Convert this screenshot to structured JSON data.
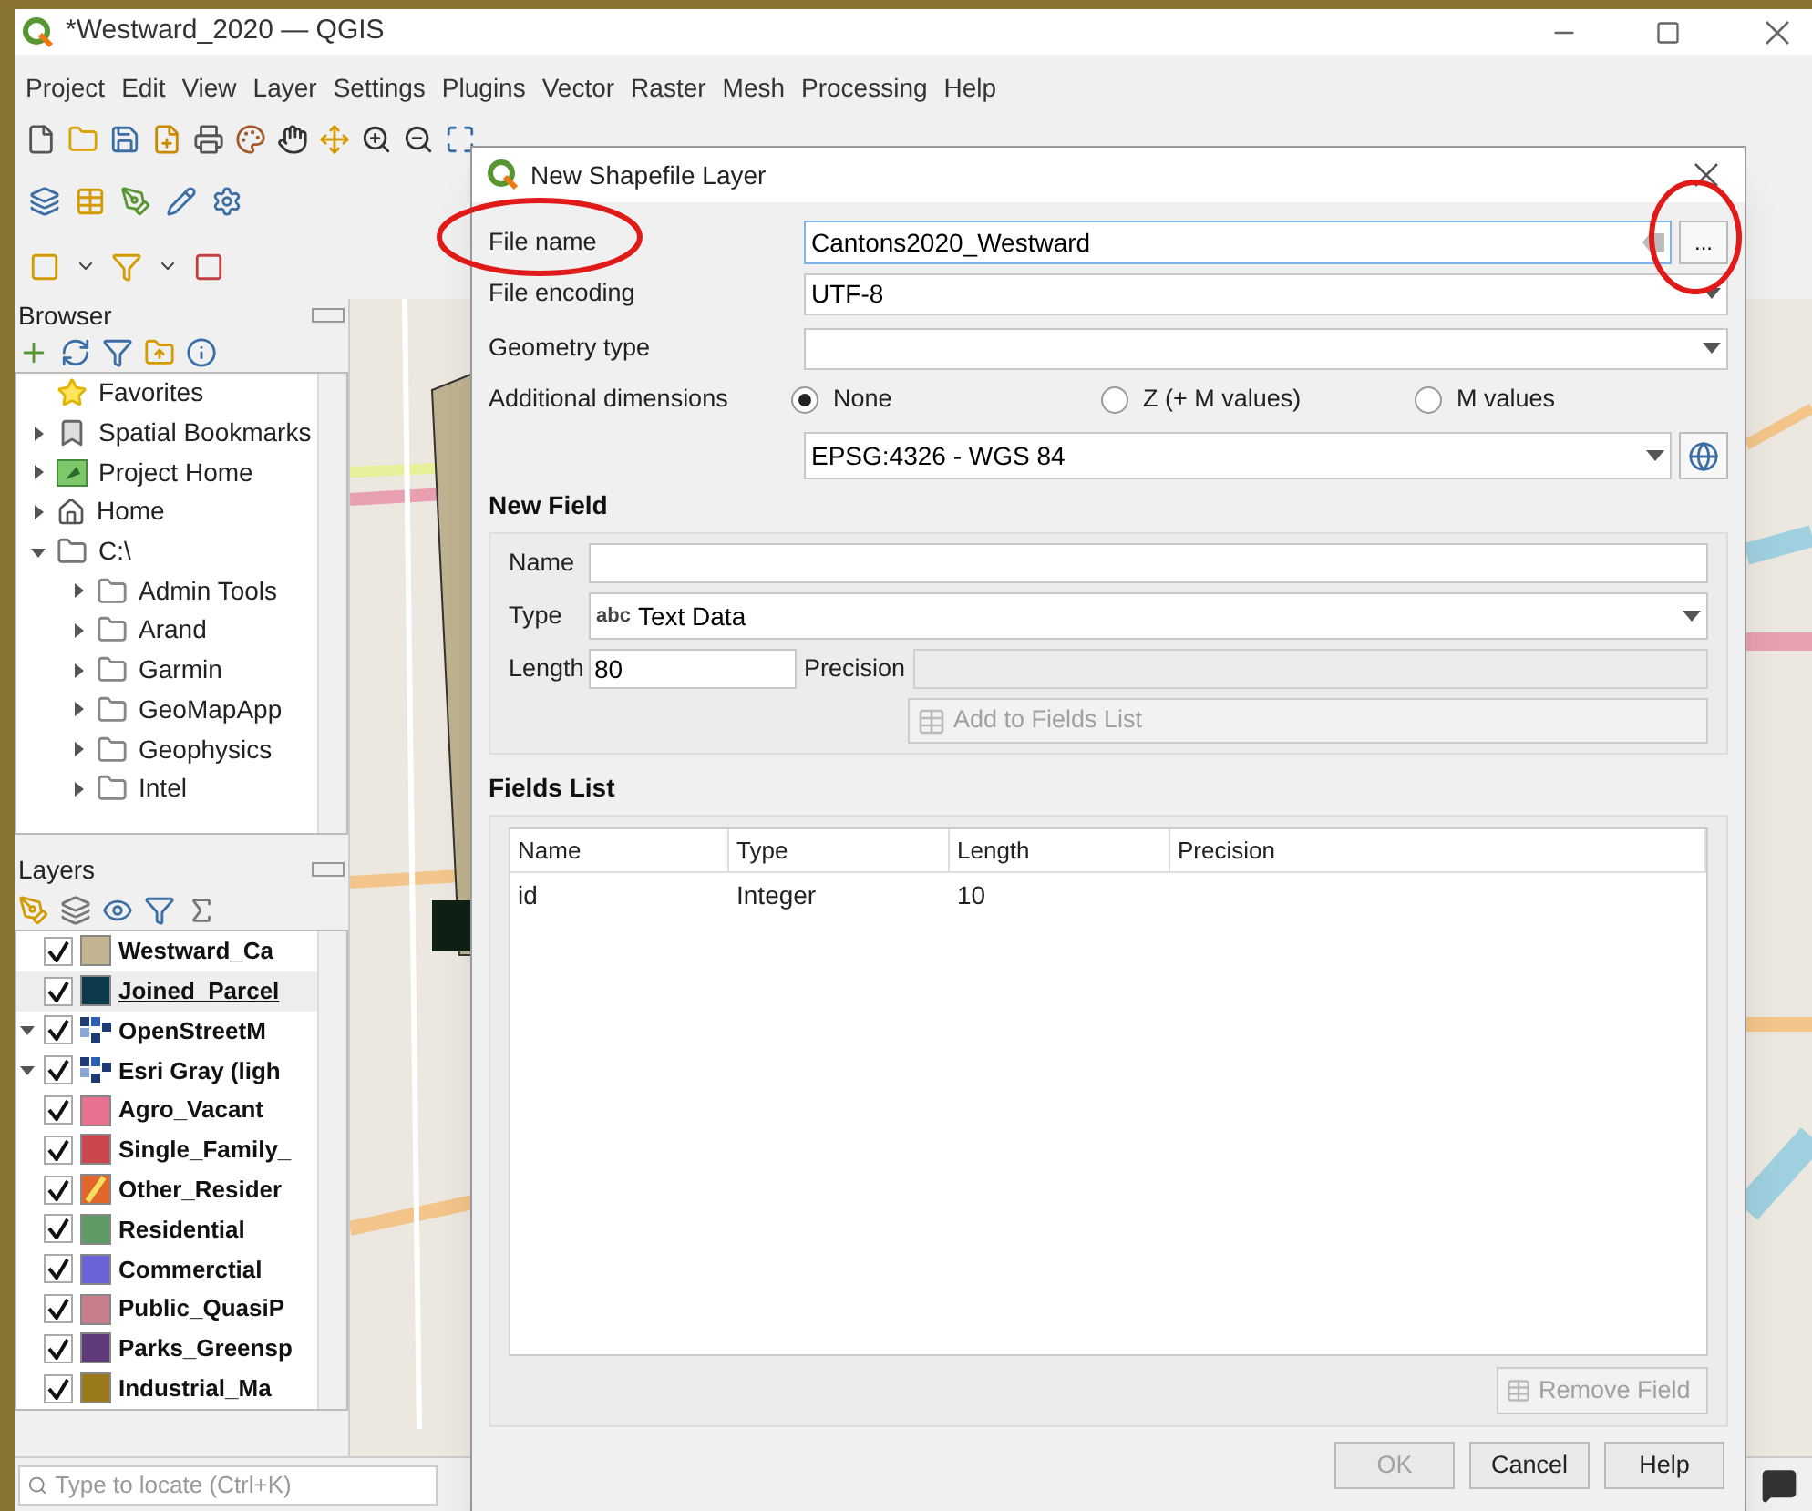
{
  "window": {
    "title": "*Westward_2020 — QGIS"
  },
  "menu": [
    "Project",
    "Edit",
    "View",
    "Layer",
    "Settings",
    "Plugins",
    "Vector",
    "Raster",
    "Mesh",
    "Processing",
    "Help"
  ],
  "browser": {
    "title": "Browser",
    "items": [
      {
        "label": "Favorites",
        "kind": "favorites"
      },
      {
        "label": "Spatial Bookmarks",
        "kind": "bookmarks",
        "expanded": false
      },
      {
        "label": "Project Home",
        "kind": "project",
        "expanded": false
      },
      {
        "label": "Home",
        "kind": "home",
        "expanded": false
      },
      {
        "label": "C:\\",
        "kind": "drive",
        "expanded": true,
        "children": [
          {
            "label": "Admin Tools",
            "kind": "folder",
            "expanded": false
          },
          {
            "label": "Arand",
            "kind": "folder",
            "expanded": false
          },
          {
            "label": "Garmin",
            "kind": "folder",
            "expanded": false
          },
          {
            "label": "GeoMapApp",
            "kind": "folder",
            "expanded": false
          },
          {
            "label": "Geophysics",
            "kind": "folder",
            "expanded": false
          },
          {
            "label": "Intel",
            "kind": "folder",
            "expanded": false
          }
        ]
      }
    ]
  },
  "layers": {
    "title": "Layers",
    "items": [
      {
        "label": "Westward_Ca",
        "kind": "fill",
        "color": "#c2b491",
        "checked": true,
        "selected": false
      },
      {
        "label": "Joined_Parcel",
        "kind": "fill",
        "color": "#0d3a4a",
        "checked": true,
        "selected": true
      },
      {
        "label": "OpenStreetM",
        "kind": "raster",
        "checked": true,
        "selected": false,
        "expanded": true
      },
      {
        "label": "Esri Gray (ligh",
        "kind": "raster",
        "checked": true,
        "selected": false,
        "expanded": true
      },
      {
        "label": "Agro_Vacant",
        "kind": "fill",
        "color": "#e8718f",
        "checked": true,
        "selected": false
      },
      {
        "label": "Single_Family_",
        "kind": "fill",
        "color": "#c9474d",
        "checked": true,
        "selected": false
      },
      {
        "label": "Other_Resider",
        "kind": "hatch",
        "color": "#e0662c",
        "checked": true,
        "selected": false
      },
      {
        "label": "Residential",
        "kind": "fill",
        "color": "#5f9a66",
        "checked": true,
        "selected": false
      },
      {
        "label": "Commerctial",
        "kind": "fill",
        "color": "#6b64d8",
        "checked": true,
        "selected": false
      },
      {
        "label": "Public_QuasiP",
        "kind": "fill",
        "color": "#c7808b",
        "checked": true,
        "selected": false
      },
      {
        "label": "Parks_Greensp",
        "kind": "fill",
        "color": "#5e3b78",
        "checked": true,
        "selected": false
      },
      {
        "label": "Industrial_Ma",
        "kind": "fill",
        "color": "#9a7a1d",
        "checked": true,
        "selected": false
      }
    ]
  },
  "locator": {
    "placeholder": "Type to locate (Ctrl+K)"
  },
  "dialog": {
    "title": "New Shapefile Layer",
    "file_name": {
      "label": "File name",
      "value": "Cantons2020_Westward",
      "browse": "..."
    },
    "file_encoding": {
      "label": "File encoding",
      "value": "UTF-8"
    },
    "geometry_type": {
      "label": "Geometry type"
    },
    "additional_dimensions": {
      "label": "Additional dimensions",
      "options": [
        {
          "label": "None",
          "selected": true
        },
        {
          "label": "Z (+ M values)",
          "selected": false
        },
        {
          "label": "M values",
          "selected": false
        }
      ]
    },
    "crs": {
      "value": "EPSG:4326 - WGS 84"
    },
    "new_field": {
      "title": "New Field",
      "name_label": "Name",
      "type_label": "Type",
      "type_badge": "abc",
      "type_value": "Text Data",
      "length_label": "Length",
      "length_value": "80",
      "precision_label": "Precision",
      "add_button": {
        "label": "Add to Fields List",
        "disabled": true
      }
    },
    "fields_list": {
      "title": "Fields List",
      "columns": [
        "Name",
        "Type",
        "Length",
        "Precision"
      ],
      "rows": [
        [
          "id",
          "Integer",
          "10",
          ""
        ]
      ]
    },
    "remove_button": {
      "label": "Remove Field",
      "disabled": true
    },
    "buttons": [
      {
        "label": "OK",
        "disabled": true
      },
      {
        "label": "Cancel",
        "disabled": false
      },
      {
        "label": "Help",
        "disabled": false
      }
    ]
  }
}
